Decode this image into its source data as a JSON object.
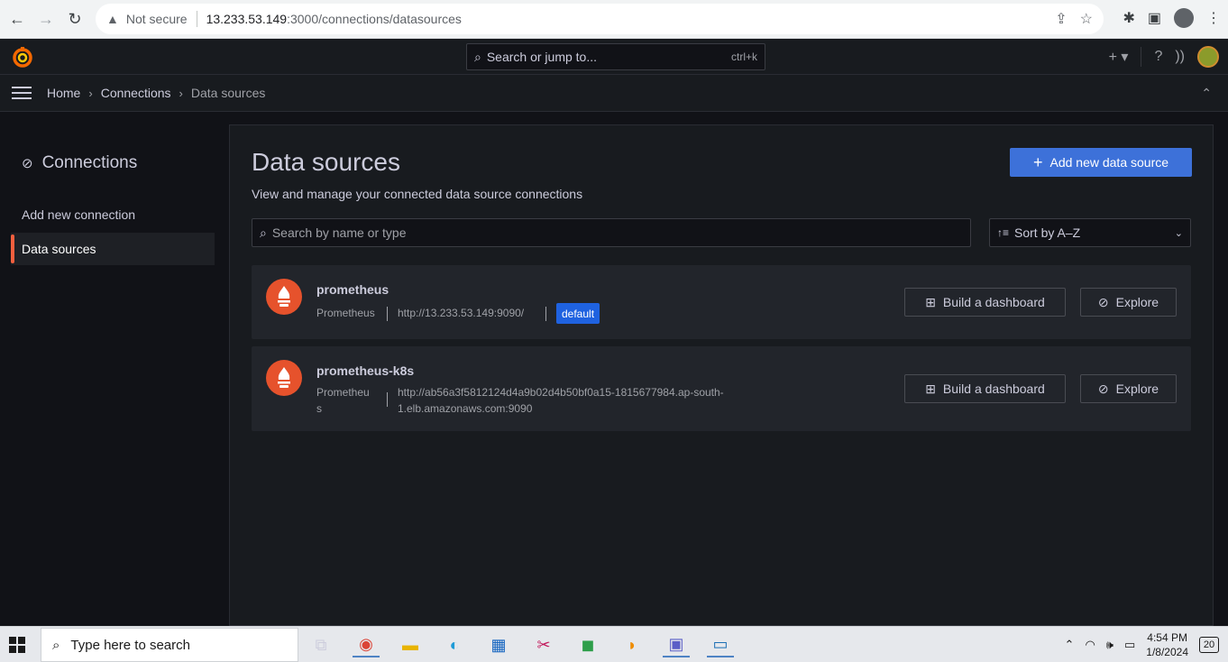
{
  "browser": {
    "security_label": "Not secure",
    "url_host": "13.233.53.149",
    "url_path": ":3000/connections/datasources"
  },
  "grafana": {
    "search_placeholder": "Search or jump to...",
    "search_shortcut": "ctrl+k",
    "breadcrumb": [
      "Home",
      "Connections",
      "Data sources"
    ]
  },
  "sidebar": {
    "title": "Connections",
    "items": [
      {
        "label": "Add new connection"
      },
      {
        "label": "Data sources"
      }
    ]
  },
  "main": {
    "title": "Data sources",
    "subtitle": "View and manage your connected data source connections",
    "add_button": "Add new data source",
    "search_placeholder": "Search by name or type",
    "sort_label": "Sort by A–Z",
    "datasources": [
      {
        "name": "prometheus",
        "type": "Prometheus",
        "url": "http://13.233.53.149:9090/",
        "badge": "default",
        "build_label": "Build a dashboard",
        "explore_label": "Explore"
      },
      {
        "name": "prometheus-k8s",
        "type_line1": "Prometheu",
        "type_line2": "s",
        "url_line1": "http://ab56a3f5812124d4a9b02d4b50bf0a15-1815677984.ap-south-",
        "url_line2": "1.elb.amazonaws.com:9090",
        "build_label": "Build a dashboard",
        "explore_label": "Explore"
      }
    ]
  },
  "taskbar": {
    "search_placeholder": "Type here to search",
    "time": "4:54 PM",
    "date": "1/8/2024",
    "notification_count": "20"
  },
  "colors": {
    "accent_blue": "#3d71d9",
    "brand_orange": "#f55f3e",
    "badge_blue": "#1f62e0"
  }
}
